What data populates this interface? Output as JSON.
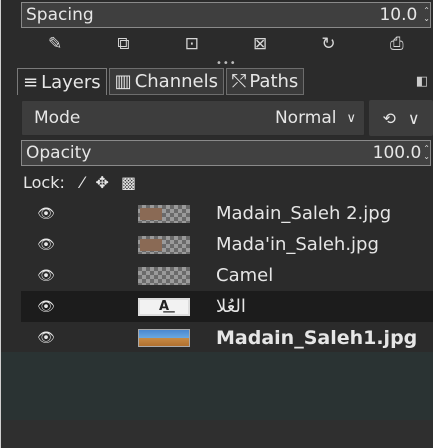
{
  "spacing": {
    "label": "Spacing",
    "value": "10.0"
  },
  "toolbar_icons": [
    "edit-icon",
    "new-tab-icon",
    "duplicate-icon",
    "close-grid-icon",
    "refresh-icon",
    "export-icon"
  ],
  "tabs": [
    {
      "label": "Layers",
      "icon": "layers-icon"
    },
    {
      "label": "Channels",
      "icon": "channels-icon"
    },
    {
      "label": "Paths",
      "icon": "paths-icon"
    }
  ],
  "mode": {
    "label": "Mode",
    "value": "Normal"
  },
  "opacity": {
    "label": "Opacity",
    "value": "100.0"
  },
  "lock": {
    "label": "Lock:"
  },
  "layers": [
    {
      "name": "Madain_Saleh 2.jpg",
      "thumb": "photo",
      "bold": false,
      "selected": false
    },
    {
      "name": "Mada'in_Saleh.jpg",
      "thumb": "photo",
      "bold": false,
      "selected": false
    },
    {
      "name": "Camel",
      "thumb": "checker",
      "bold": false,
      "selected": false
    },
    {
      "name": "العُلا",
      "thumb": "text",
      "bold": false,
      "selected": true
    },
    {
      "name": "Madain_Saleh1.jpg",
      "thumb": "sky",
      "bold": true,
      "selected": false
    }
  ]
}
